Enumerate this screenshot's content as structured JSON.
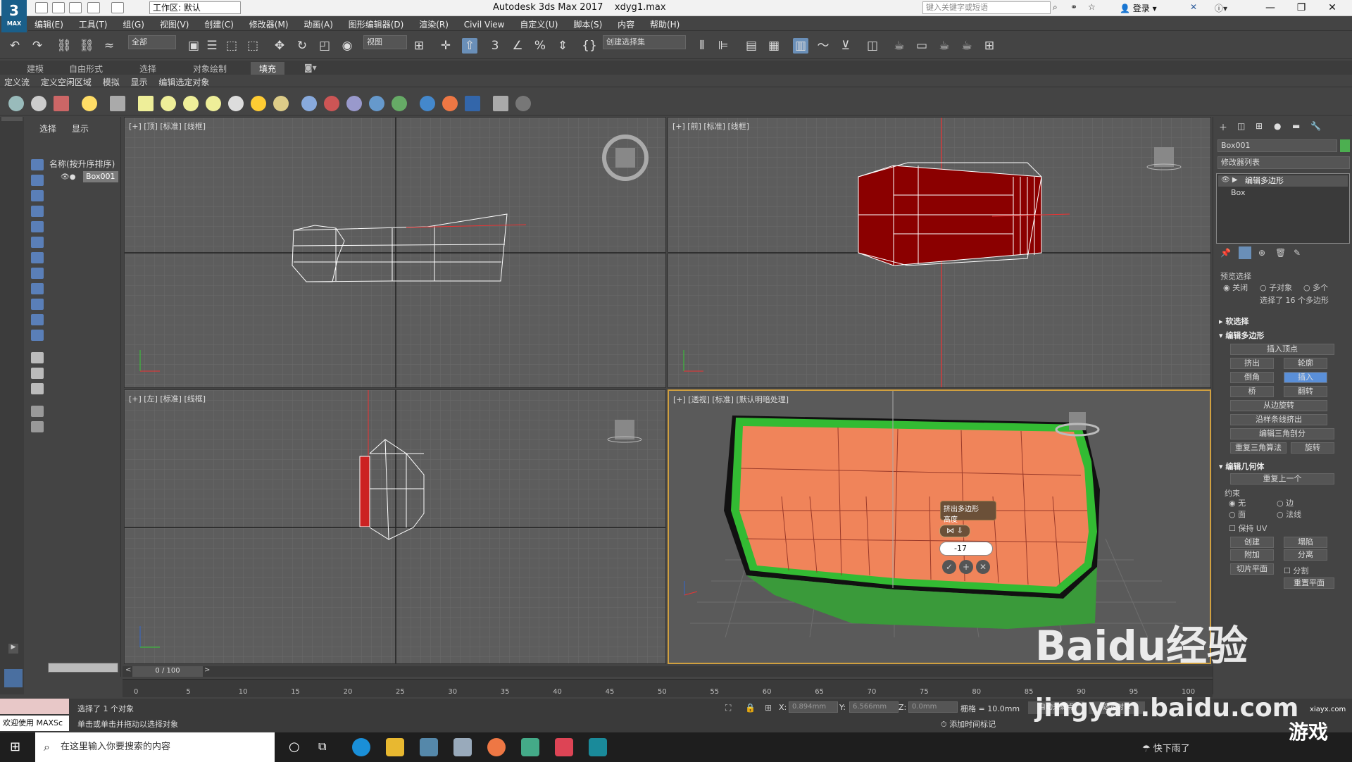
{
  "app": {
    "window_title": "Autodesk 3ds Max 2017",
    "file_name": "xdyg1.max",
    "logo_text": "3",
    "logo_sub": "MAX",
    "workspace": "工作区: 默认",
    "search_placeholder": "键入关键字或短语",
    "login_label": "登录"
  },
  "menu": [
    "编辑(E)",
    "工具(T)",
    "组(G)",
    "视图(V)",
    "创建(C)",
    "修改器(M)",
    "动画(A)",
    "图形编辑器(D)",
    "渲染(R)",
    "Civil View",
    "自定义(U)",
    "脚本(S)",
    "内容",
    "帮助(H)"
  ],
  "toolbar": {
    "filter": "全部",
    "ref_coord": "视图",
    "selection_set": "创建选择集"
  },
  "ribbon": {
    "tabs": [
      "建模",
      "自由形式",
      "选择",
      "对象绘制",
      "填充"
    ],
    "active_tab": "填充",
    "sub": [
      "定义流",
      "定义空闲区域",
      "模拟",
      "显示",
      "编辑选定对象"
    ]
  },
  "scene_explorer": {
    "tabs": [
      "选择",
      "显示"
    ],
    "header": "名称(按升序排序)",
    "object": "Box001"
  },
  "viewports": {
    "top": "[+] [顶] [标准] [线框]",
    "front": "[+] [前] [标准] [线框]",
    "left": "[+] [左] [标准] [线框]",
    "persp": "[+] [透视] [标准] [默认明暗处理]",
    "caddy_title": "挤出多边形",
    "caddy_sub": "高度",
    "caddy_value": "-17"
  },
  "command_panel": {
    "object_name": "Box001",
    "object_color": "#4caf50",
    "modifier_list": "修改器列表",
    "stack": [
      "编辑多边形",
      "Box"
    ],
    "preview_title": "预览选择",
    "preview_options": [
      "关闭",
      "子对象",
      "多个"
    ],
    "selected_info": "选择了 16 个多边形",
    "soft_sel": "软选择",
    "edit_poly_title": "编辑多边形",
    "insert_vertex": "插入顶点",
    "extrude": "挤出",
    "outline": "轮廓",
    "bevel": "倒角",
    "inset": "插入",
    "bridge": "桥",
    "flip": "翻转",
    "hinge": "从边旋转",
    "extrude_spline": "沿样条线挤出",
    "edit_tri": "编辑三角剖分",
    "retri": "重复三角算法",
    "turn": "旋转",
    "edit_geom_title": "编辑几何体",
    "repeat_last": "重复上一个",
    "constraints": "约束",
    "c_none": "无",
    "c_edge": "边",
    "c_face": "面",
    "c_normal": "法线",
    "preserve_uv": "保持 UV",
    "create": "创建",
    "collapse": "塌陷",
    "attach": "附加",
    "detach": "分离",
    "slice_plane": "切片平面",
    "split": "分割",
    "reset_plane": "重置平面"
  },
  "timeline": {
    "frame": "0 / 100",
    "ticks": [
      "0",
      "5",
      "10",
      "15",
      "20",
      "25",
      "30",
      "35",
      "40",
      "45",
      "50",
      "55",
      "60",
      "65",
      "70",
      "75",
      "80",
      "85",
      "90",
      "95",
      "100"
    ]
  },
  "status": {
    "selected": "选择了 1 个对象",
    "hint": "单击或单击并拖动以选择对象",
    "welcome": "欢迎使用 MAXSc",
    "x_label": "X:",
    "x_val": "0.894mm",
    "y_label": "Y:",
    "y_val": "6.566mm",
    "z_label": "Z:",
    "z_val": "0.0mm",
    "grid": "栅格 = 10.0mm",
    "add_tag": "添加时间标记",
    "auto_key": "自动关键点",
    "set_key": "选定对象"
  },
  "taskbar": {
    "search": "在这里输入你要搜索的内容",
    "weather": "快下雨了"
  },
  "watermark": {
    "brand": "Bai",
    "brand2": "du",
    "brand3": "经验",
    "url": "jingyan.baidu.com",
    "site": "游戏",
    "site_url": "xiayx.com"
  }
}
